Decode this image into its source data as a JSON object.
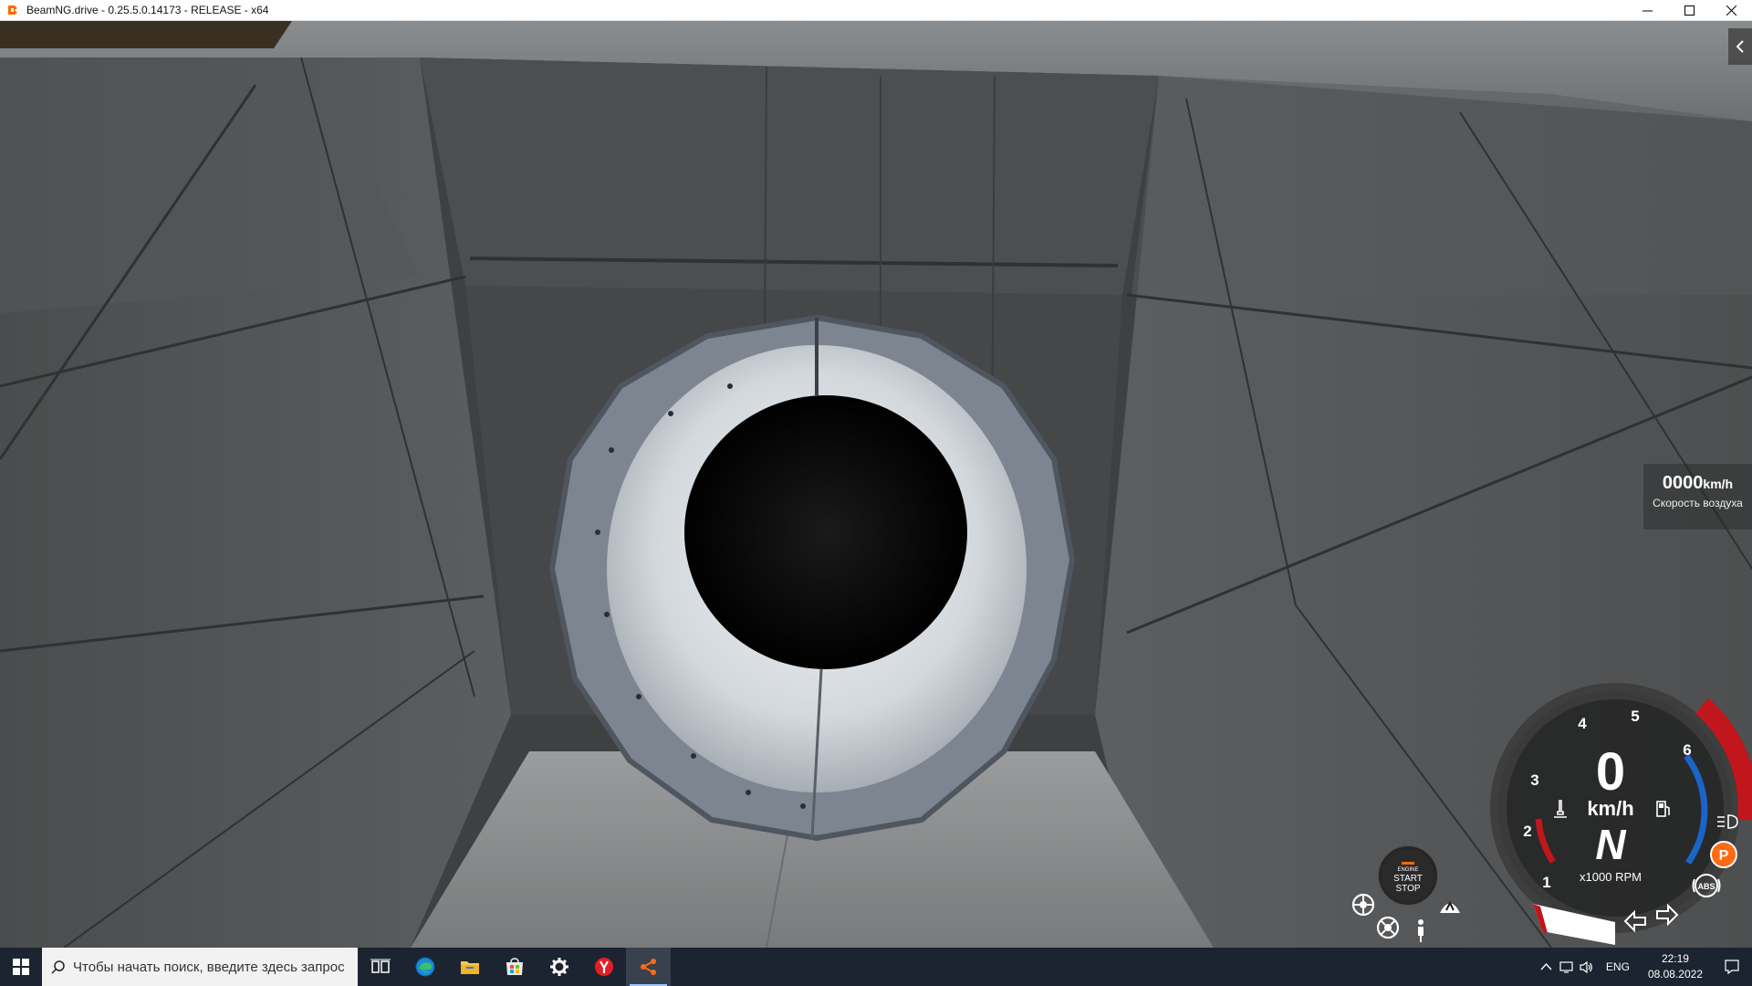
{
  "window": {
    "title": "BeamNG.drive - 0.25.5.0.14173 - RELEASE - x64",
    "app_icon": "beamng-logo-icon",
    "controls": [
      "minimize-icon",
      "maximize-icon",
      "close-icon"
    ]
  },
  "hud": {
    "airspeed": {
      "value": "0000",
      "unit": "km/h",
      "label": "Скорость воздуха"
    },
    "speedometer": {
      "speed": "0",
      "speed_unit": "km/h",
      "gear": "N",
      "rpm_unit": "x1000 RPM",
      "rpm_ticks": [
        "1",
        "2",
        "3",
        "4",
        "5",
        "6"
      ]
    },
    "engine_button": {
      "top": "ENGINE",
      "line1": "START",
      "line2": "STOP"
    },
    "indicators": {
      "parking": "P",
      "abs": "ABS",
      "icons": [
        "temperature-icon",
        "fuel-icon",
        "headlight-icon",
        "parking-brake-icon",
        "abs-icon",
        "turn-left-icon",
        "turn-right-icon",
        "esc-icon",
        "tcs-icon",
        "seatbelt-icon",
        "hazard-icon"
      ]
    },
    "colors": {
      "redline": "#c0161c",
      "rpm_blue": "#1b64c9",
      "parking_orange": "#ff6a13"
    }
  },
  "taskbar": {
    "search_placeholder": "Чтобы начать поиск, введите здесь запрос",
    "apps": [
      "task-view-icon",
      "edge-icon",
      "file-explorer-icon",
      "store-icon",
      "settings-icon",
      "yandex-browser-icon",
      "beamng-icon"
    ],
    "tray": {
      "lang": "ENG",
      "time": "22:19",
      "date": "08.08.2022"
    }
  }
}
